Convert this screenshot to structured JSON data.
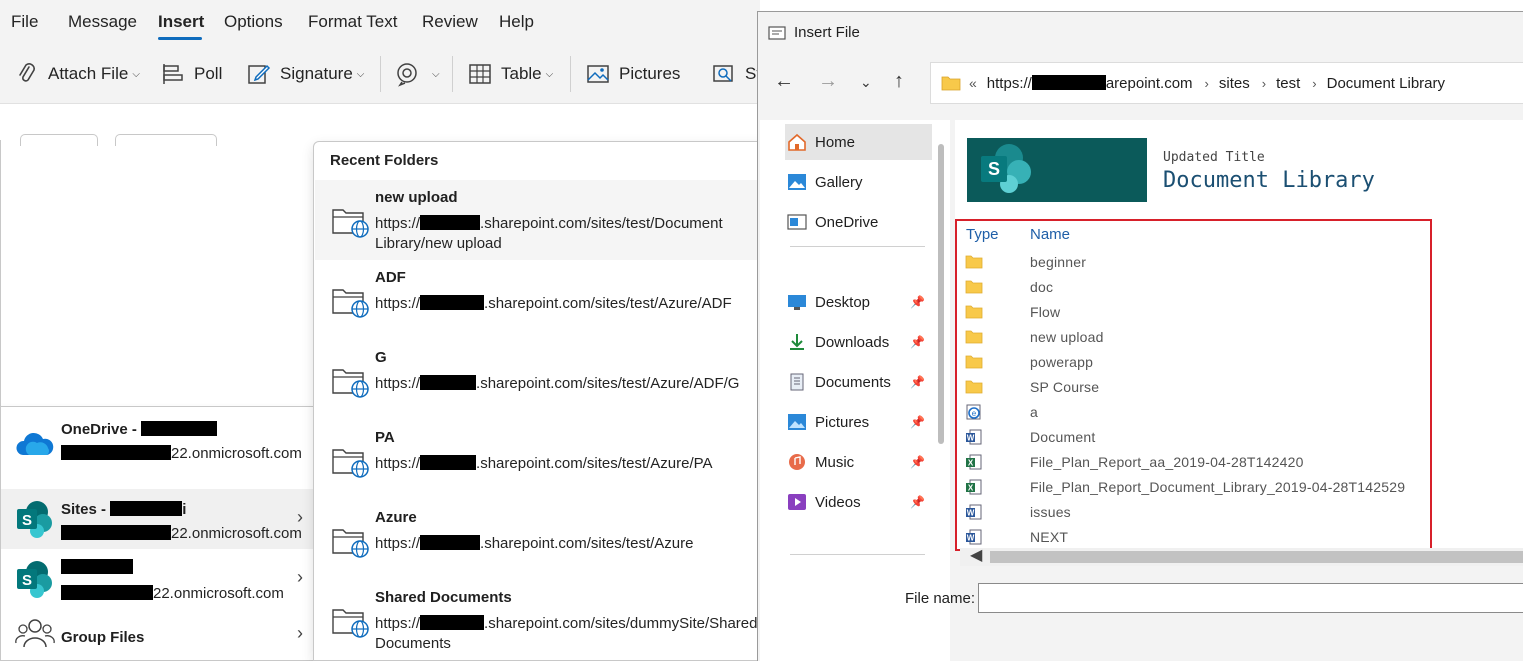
{
  "ribbon": {
    "menu": [
      "File",
      "Message",
      "Insert",
      "Options",
      "Format Text",
      "Review",
      "Help"
    ],
    "active_menu": "Insert",
    "attach_file": "Attach File",
    "poll": "Poll",
    "signature": "Signature",
    "table": "Table",
    "pictures": "Pictures",
    "truncated": "St"
  },
  "locations": {
    "onedrive_title": "OneDrive -",
    "onedrive_sub": "22.onmicrosoft.com",
    "sites_title": "Sites -",
    "sites_suffix": "i",
    "sites_sub": "22.onmicrosoft.com",
    "site2_sub": "22.onmicrosoft.com",
    "group_files": "Group Files"
  },
  "recent": {
    "header": "Recent Folders",
    "items": [
      {
        "name": "new upload",
        "pre": "https://",
        "path": ".sharepoint.com/sites/test/Document Library/new upload"
      },
      {
        "name": "ADF",
        "pre": "https://",
        "path": ".sharepoint.com/sites/test/Azure/ADF"
      },
      {
        "name": "G",
        "pre": "https://",
        "path": ".sharepoint.com/sites/test/Azure/ADF/G"
      },
      {
        "name": "PA",
        "pre": "https://",
        "path": ".sharepoint.com/sites/test/Azure/PA"
      },
      {
        "name": "Azure",
        "pre": "https://",
        "path": ".sharepoint.com/sites/test/Azure"
      },
      {
        "name": "Shared Documents",
        "pre": "https://",
        "path": ".sharepoint.com/sites/dummySite/Shared Documents"
      }
    ]
  },
  "dialog": {
    "title": "Insert File",
    "address": {
      "prefix": "https://",
      "host_suffix": "arepoint.com",
      "crumbs": [
        "sites",
        "test",
        "Document Library"
      ]
    },
    "nav": {
      "home": "Home",
      "gallery": "Gallery",
      "onedrive": "OneDrive",
      "desktop": "Desktop",
      "downloads": "Downloads",
      "documents": "Documents",
      "pictures": "Pictures",
      "music": "Music",
      "videos": "Videos"
    },
    "banner": {
      "subtitle": "Updated Title",
      "title": "Document Library",
      "logo_letter": "S"
    },
    "columns": {
      "type": "Type",
      "name": "Name"
    },
    "files": [
      {
        "type": "folder",
        "name": "beginner"
      },
      {
        "type": "folder",
        "name": "doc"
      },
      {
        "type": "folder",
        "name": "Flow"
      },
      {
        "type": "folder",
        "name": "new upload"
      },
      {
        "type": "folder",
        "name": "powerapp"
      },
      {
        "type": "folder",
        "name": "SP Course"
      },
      {
        "type": "web",
        "name": "a"
      },
      {
        "type": "word",
        "name": "Document"
      },
      {
        "type": "excel",
        "name": "File_Plan_Report_aa_2019-04-28T142420"
      },
      {
        "type": "excel",
        "name": "File_Plan_Report_Document_Library_2019-04-28T142529"
      },
      {
        "type": "word",
        "name": "issues"
      },
      {
        "type": "word",
        "name": "NEXT"
      }
    ],
    "file_name_label": "File name:",
    "file_name_value": ""
  },
  "colors": {
    "accent": "#0f6cbd",
    "highlight_box": "#d7202a",
    "sharepoint": "#0b5a5a",
    "link_blue": "#1f5fa8"
  }
}
